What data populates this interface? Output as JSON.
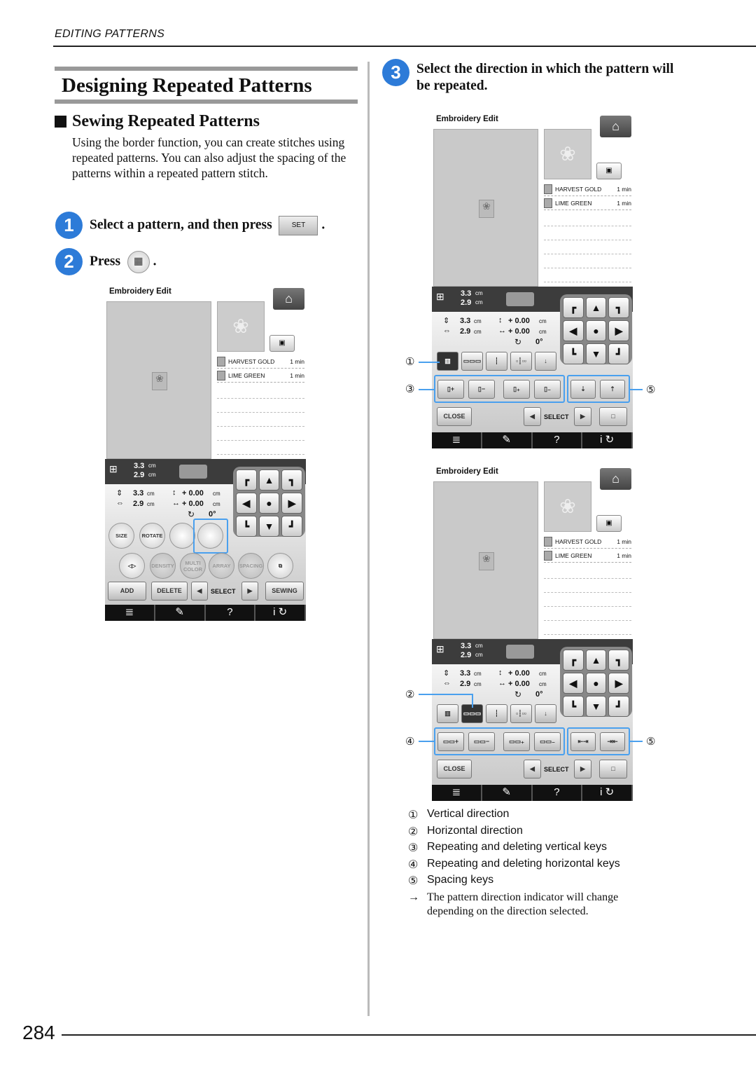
{
  "running_head": "EDITING PATTERNS",
  "section_title": "Designing Repeated Patterns",
  "subsection_title": "Sewing Repeated Patterns",
  "intro": "Using the border function, you can create stitches using repeated patterns. You can also adjust the spacing of the patterns within a repeated pattern stitch.",
  "steps": [
    {
      "num": "1",
      "text": "Select a pattern, and then press",
      "button": "SET",
      "end": "."
    },
    {
      "num": "2",
      "text": "Press",
      "icon": "border-icon",
      "end": "."
    },
    {
      "num": "3",
      "text": "Select the direction in which the pattern will be repeated."
    }
  ],
  "screen": {
    "title": "Embroidery Edit",
    "colors": [
      {
        "name": "HARVEST GOLD",
        "time": "1 min"
      },
      {
        "name": "LIME GREEN",
        "time": "1 min"
      }
    ],
    "size_h": "3.3",
    "size_w": "2.9",
    "unit": "cm",
    "offset_v": "+ 0.00",
    "offset_h": "+ 0.00",
    "rotation": "0°",
    "edit_buttons_row1": [
      "SIZE",
      "ROTATE",
      "",
      ""
    ],
    "edit_buttons_row2": [
      "",
      "DENSITY",
      "MULTI COLOR",
      "ARRAY",
      "SPACING",
      ""
    ],
    "add": "ADD",
    "delete": "DELETE",
    "select": "SELECT",
    "sewing": "SEWING",
    "close": "CLOSE",
    "nav": [
      "≣",
      "✎",
      "?",
      "i ↻"
    ]
  },
  "callouts": {
    "c1": "①",
    "c2": "②",
    "c3": "③",
    "c4": "④",
    "c5": "⑤"
  },
  "legend": [
    {
      "mark": "①",
      "text": "Vertical direction"
    },
    {
      "mark": "②",
      "text": "Horizontal direction"
    },
    {
      "mark": "③",
      "text": "Repeating and deleting vertical keys"
    },
    {
      "mark": "④",
      "text": "Repeating and deleting horizontal keys"
    },
    {
      "mark": "⑤",
      "text": "Spacing keys"
    },
    {
      "mark": "→",
      "text": "The pattern direction indicator will change depending on the direction selected."
    }
  ],
  "page_number": "284",
  "accent_color": "#2d7bd8"
}
